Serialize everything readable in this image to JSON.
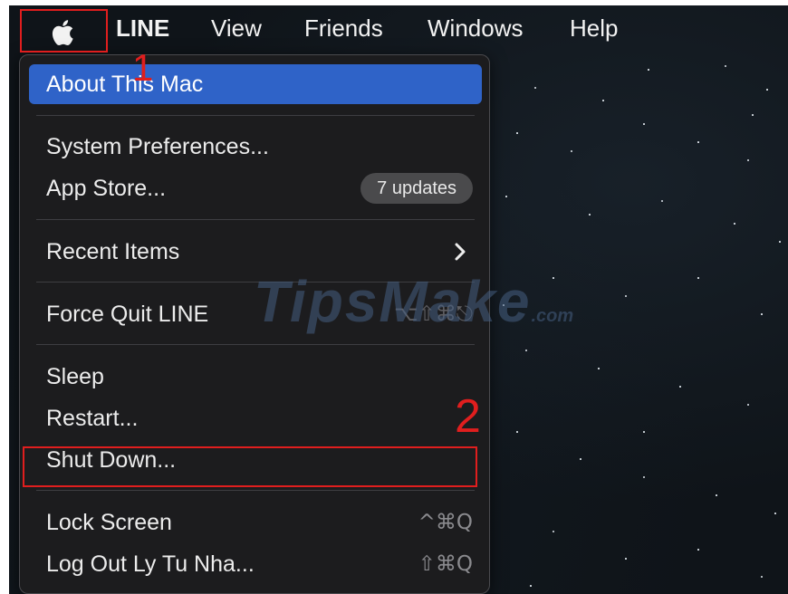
{
  "menubar": {
    "apple_icon": "apple-logo-icon",
    "items": [
      {
        "label": "LINE",
        "bold": true
      },
      {
        "label": "View"
      },
      {
        "label": "Friends"
      },
      {
        "label": "Windows"
      },
      {
        "label": "Help"
      }
    ]
  },
  "apple_menu": {
    "about": "About This Mac",
    "system_preferences": "System Preferences...",
    "app_store": "App Store...",
    "app_store_badge": "7 updates",
    "recent_items": "Recent Items",
    "recent_items_icon": "chevron-right-icon",
    "force_quit": "Force Quit LINE",
    "force_quit_shortcut": "⌥⇧⌘⎋",
    "sleep": "Sleep",
    "restart": "Restart...",
    "shut_down": "Shut Down...",
    "lock_screen": "Lock Screen",
    "lock_screen_shortcut": "^⌘Q",
    "log_out": "Log Out Ly Tu Nha...",
    "log_out_shortcut": "⇧⌘Q"
  },
  "annotations": {
    "step1": "1",
    "step2": "2",
    "color": "#e01e1e"
  },
  "watermark": {
    "text": "TipsMake",
    "suffix": ".com"
  },
  "colors": {
    "highlight": "#2f63c8",
    "menu_background": "#1c1c1e",
    "desktop": "#0f1419"
  }
}
